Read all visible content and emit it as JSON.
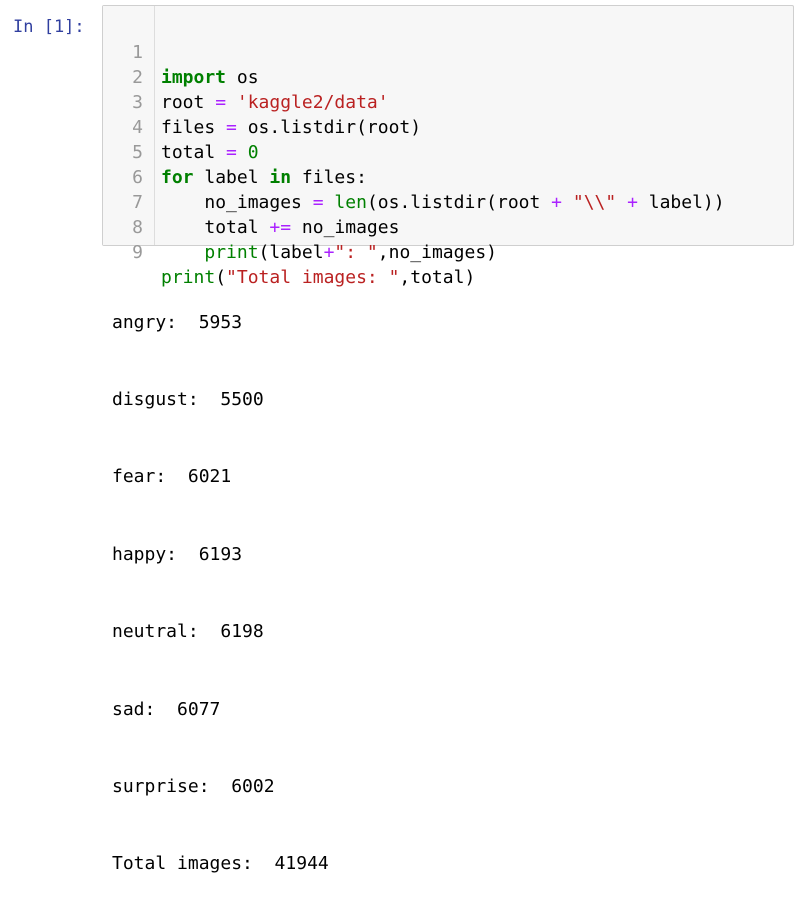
{
  "cell": {
    "prompt": "In [1]:",
    "line_numbers": [
      "1",
      "2",
      "3",
      "4",
      "5",
      "6",
      "7",
      "8",
      "9"
    ],
    "code": {
      "l1": {
        "kw_import": "import",
        "rest": " os"
      },
      "l2": {
        "a": "root ",
        "eq": "=",
        "sp": " ",
        "str": "'kaggle2/data'"
      },
      "l3": {
        "a": "files ",
        "eq": "=",
        "rest": " os.listdir(root)"
      },
      "l4": {
        "a": "total ",
        "eq": "=",
        "sp": " ",
        "num": "0"
      },
      "l5": {
        "kw_for": "for",
        "mid": " label ",
        "kw_in": "in",
        "rest": " files:"
      },
      "l6": {
        "indent": "    ",
        "a": "no_images ",
        "eq": "=",
        "sp": " ",
        "fn": "len",
        "b": "(os.listdir(root ",
        "plus1": "+",
        "sp2": " ",
        "str": "\"\\\\\"",
        "sp3": " ",
        "plus2": "+",
        "c": " label))"
      },
      "l7": {
        "indent": "    ",
        "a": "total ",
        "op": "+=",
        "rest": " no_images"
      },
      "l8": {
        "indent": "    ",
        "fn": "print",
        "a": "(label",
        "plus": "+",
        "str": "\": \"",
        "rest": ",no_images)"
      },
      "l9": {
        "fn": "print",
        "a": "(",
        "str": "\"Total images: \"",
        "rest": ",total)"
      }
    }
  },
  "output": {
    "lines": [
      "angry:  5953",
      "disgust:  5500",
      "fear:  6021",
      "happy:  6193",
      "neutral:  6198",
      "sad:  6077",
      "surprise:  6002",
      "Total images:  41944"
    ]
  }
}
